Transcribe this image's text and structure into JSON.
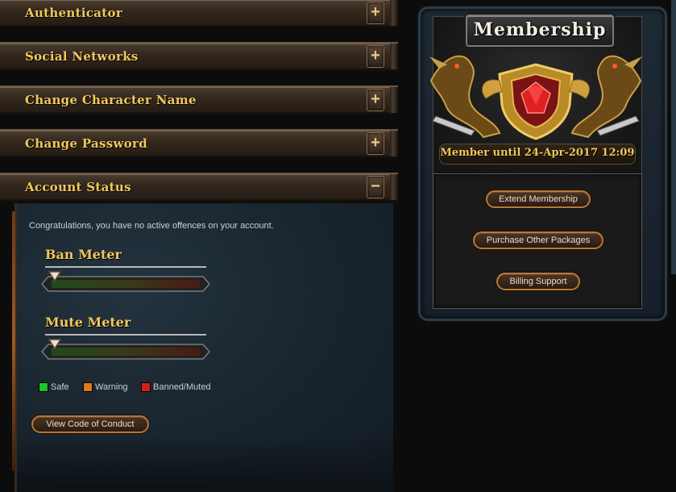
{
  "accordion": {
    "items": [
      {
        "label": "Authenticator",
        "toggle": "+"
      },
      {
        "label": "Social Networks",
        "toggle": "+"
      },
      {
        "label": "Change Character Name",
        "toggle": "+"
      },
      {
        "label": "Change Password",
        "toggle": "+"
      },
      {
        "label": "Account Status",
        "toggle": "−"
      }
    ]
  },
  "account_status": {
    "message": "Congratulations, you have no active offences on your account.",
    "ban_meter": {
      "title": "Ban Meter",
      "level": 0
    },
    "mute_meter": {
      "title": "Mute Meter",
      "level": 0
    },
    "legend": [
      {
        "label": "Safe",
        "color": "#22c02a"
      },
      {
        "label": "Warning",
        "color": "#e07a18"
      },
      {
        "label": "Banned/Muted",
        "color": "#d4201c"
      }
    ],
    "conduct_button": "View Code of Conduct"
  },
  "membership": {
    "title": "Membership",
    "member_until": "Member until 24-Apr-2017 12:09",
    "buttons": {
      "extend": "Extend Membership",
      "purchase": "Purchase Other Packages",
      "billing": "Billing Support"
    }
  },
  "colors": {
    "accent_gold": "#f2c85c",
    "panel_bg": "#1a2630"
  }
}
